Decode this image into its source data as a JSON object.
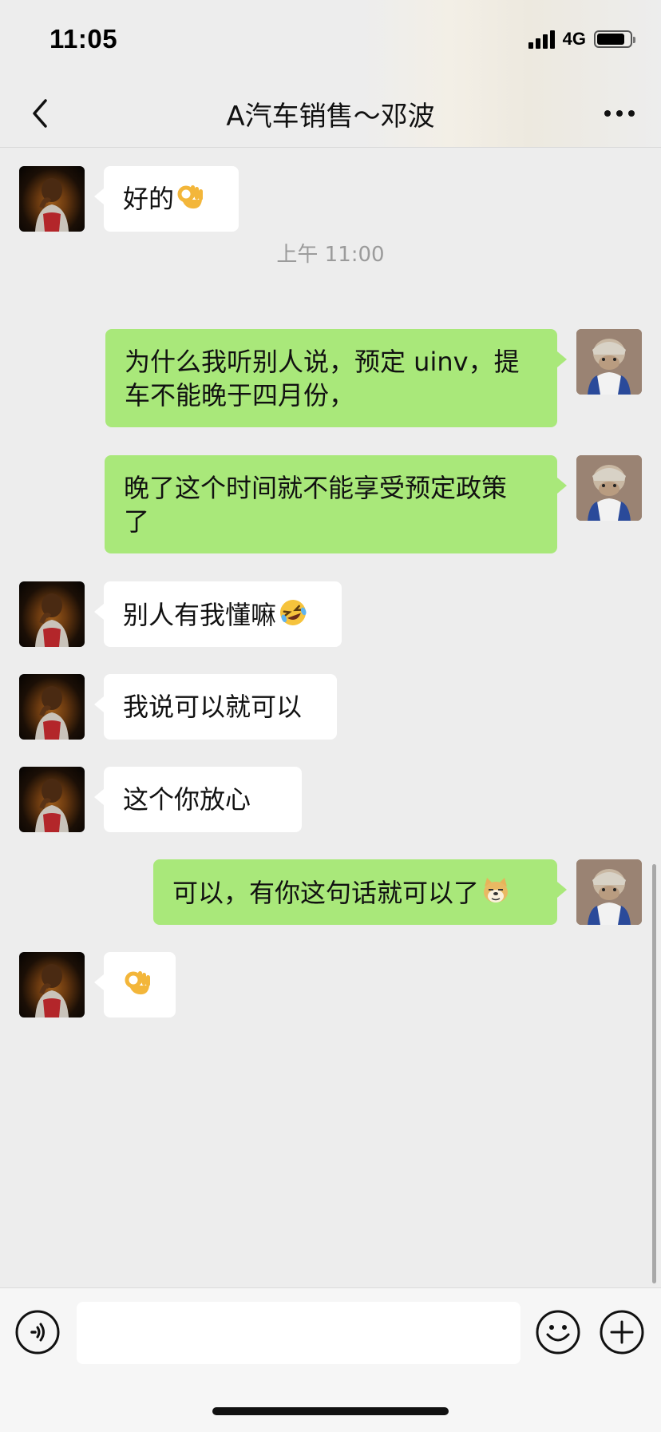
{
  "status_bar": {
    "time": "11:05",
    "network": "4G"
  },
  "nav": {
    "title": "A汽车销售～邓波",
    "back_icon": "chevron-left-icon",
    "more_icon": "more-dots-icon"
  },
  "messages": [
    {
      "side": "in",
      "text": "好的",
      "emoji": "ok-hand-emoji"
    },
    {
      "side": "in",
      "text": "别人有我懂嘛",
      "emoji": "rolling-laugh-emoji"
    },
    {
      "side": "in",
      "text": "我说可以就可以"
    },
    {
      "side": "in",
      "text": "这个你放心"
    },
    {
      "side": "in",
      "text": "",
      "emoji": "ok-hand-emoji"
    }
  ],
  "outgoing": [
    {
      "lines": [
        "为什么我听别人说，预定 uinv，提",
        "车不能晚于四月份，"
      ]
    },
    {
      "lines": [
        "晚了这个时间就不能享受预定政策",
        "了"
      ]
    },
    {
      "text": "可以，有你这句话就可以了",
      "emoji": "doge-emoji"
    }
  ],
  "timestamp": "上午 11:00",
  "input_bar": {
    "voice_icon": "voice-icon",
    "emoji_icon": "smiley-icon",
    "plus_icon": "plus-icon",
    "value": ""
  },
  "colors": {
    "background": "#ededed",
    "bubble_in": "#ffffff",
    "bubble_out": "#a9e87a",
    "timestamp": "#9b9b9b"
  }
}
